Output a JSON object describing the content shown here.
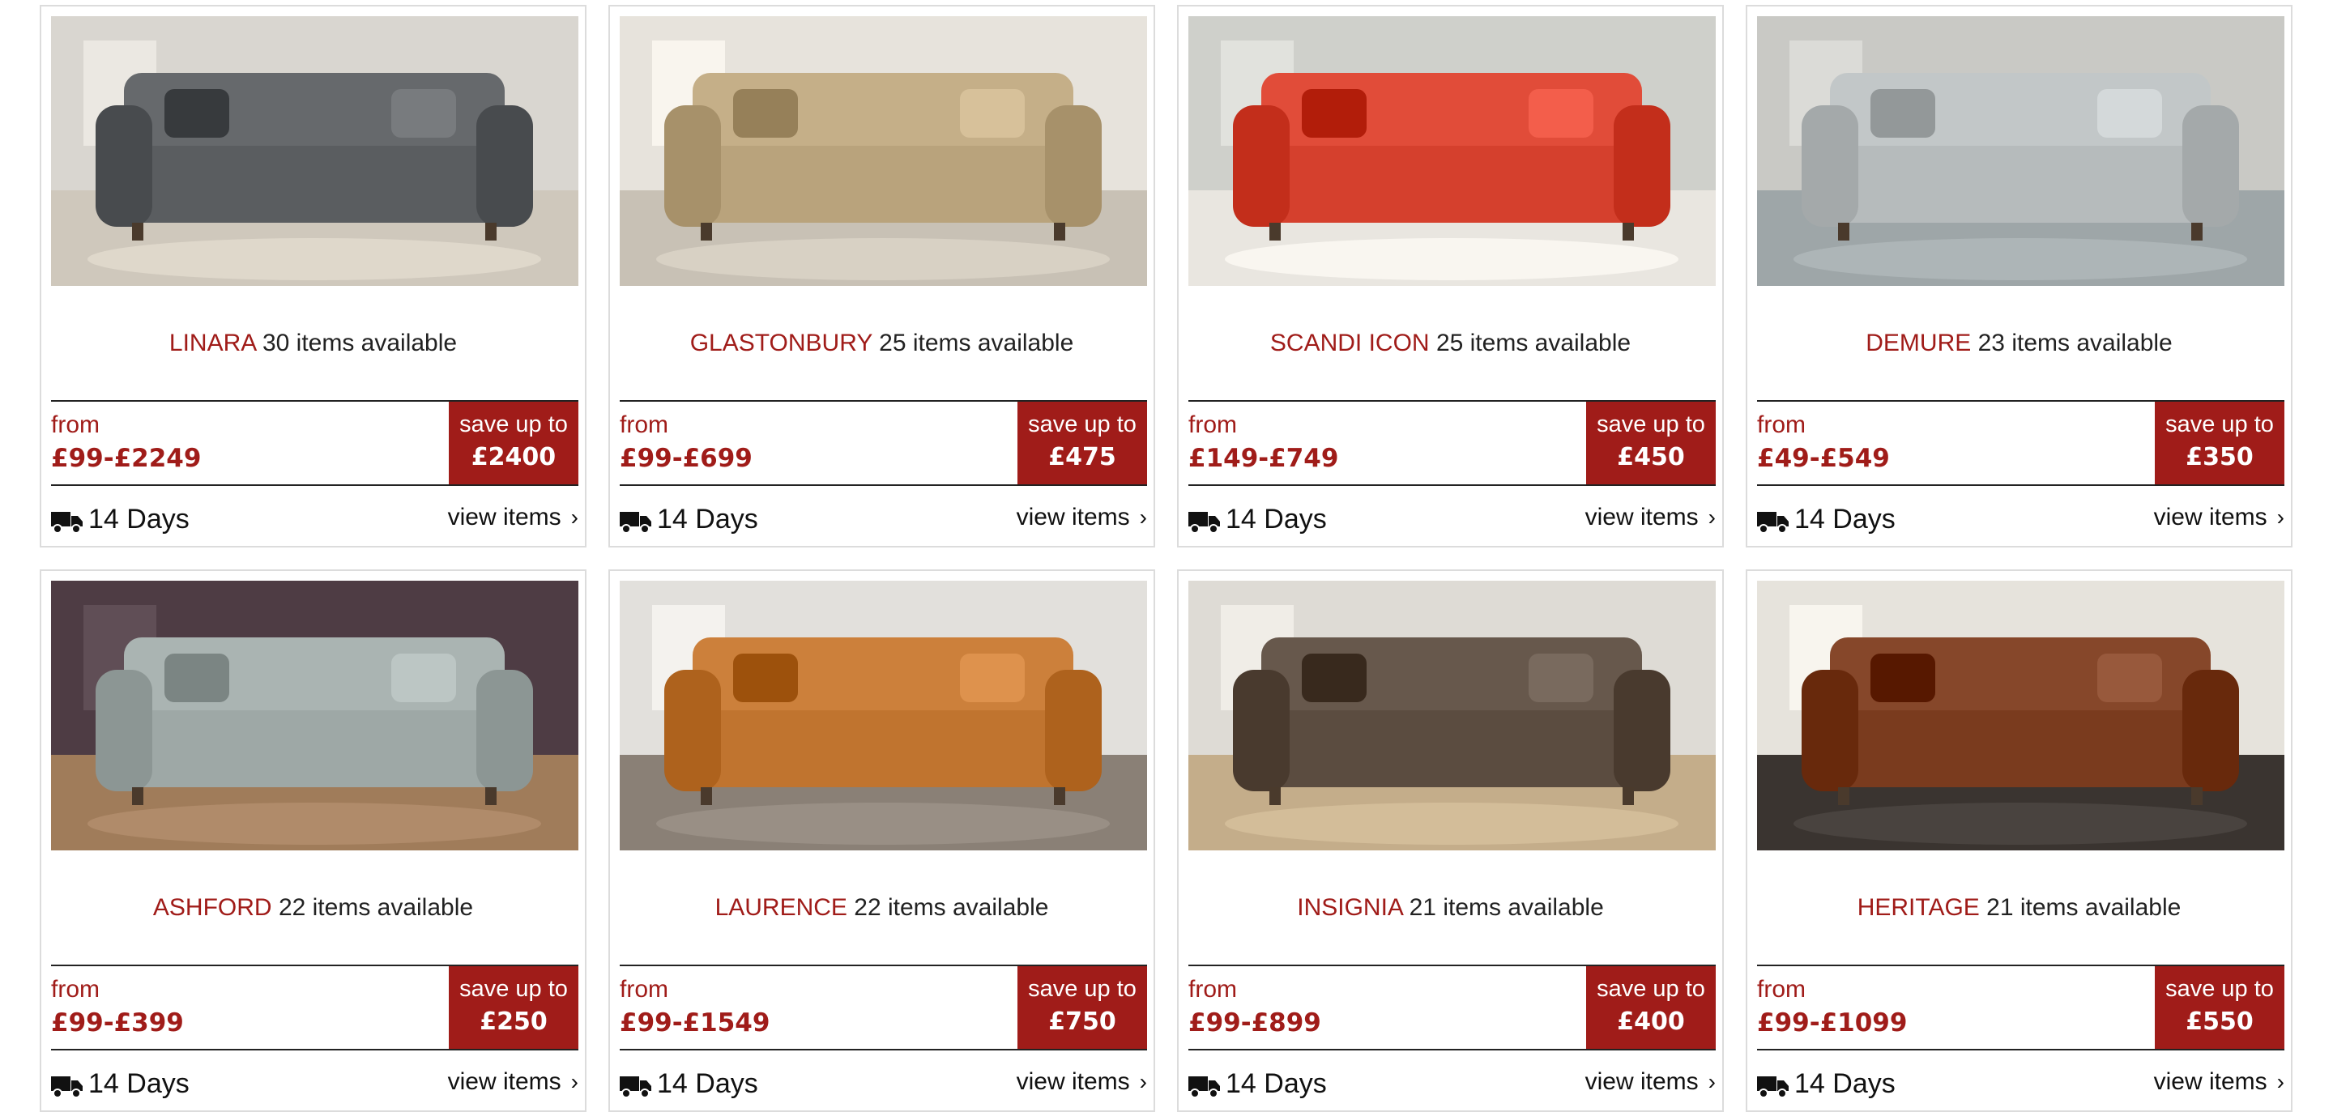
{
  "products": [
    {
      "name": "LINARA",
      "count": "30 items available",
      "from": "from",
      "range": "£99-£2249",
      "save_label": "save up to",
      "save_amount": "£2400",
      "delivery": "14 Days",
      "view": "view items",
      "image_desc": "grey leather sofa",
      "colors": {
        "sofa": "#5a5d60",
        "wall": "#d9d6d0",
        "floor": "#cfc8bc"
      }
    },
    {
      "name": "GLASTONBURY",
      "count": "25 items available",
      "from": "from",
      "range": "£99-£699",
      "save_label": "save up to",
      "save_amount": "£475",
      "delivery": "14 Days",
      "view": "view items",
      "image_desc": "beige fabric sofa",
      "colors": {
        "sofa": "#b9a37c",
        "wall": "#e7e3dc",
        "floor": "#c8c1b5"
      }
    },
    {
      "name": "SCANDI ICON",
      "count": "25 items available",
      "from": "from",
      "range": "£149-£749",
      "save_label": "save up to",
      "save_amount": "£450",
      "delivery": "14 Days",
      "view": "view items",
      "image_desc": "red fabric sofa",
      "colors": {
        "sofa": "#d5402d",
        "wall": "#cfd0cb",
        "floor": "#e9e6e0"
      }
    },
    {
      "name": "DEMURE",
      "count": "23 items available",
      "from": "from",
      "range": "£49-£549",
      "save_label": "save up to",
      "save_amount": "£350",
      "delivery": "14 Days",
      "view": "view items",
      "image_desc": "light grey corner sofa",
      "colors": {
        "sofa": "#b6bbbc",
        "wall": "#c9c9c5",
        "floor": "#9ea6a8"
      }
    },
    {
      "name": "ASHFORD",
      "count": "22 items available",
      "from": "from",
      "range": "£99-£399",
      "save_label": "save up to",
      "save_amount": "£250",
      "delivery": "14 Days",
      "view": "view items",
      "image_desc": "sage green fabric sofa",
      "colors": {
        "sofa": "#9ea8a6",
        "wall": "#4e3c44",
        "floor": "#a07c5a"
      }
    },
    {
      "name": "LAURENCE",
      "count": "22 items available",
      "from": "from",
      "range": "£99-£1549",
      "save_label": "save up to",
      "save_amount": "£750",
      "delivery": "14 Days",
      "view": "view items",
      "image_desc": "tan leather corner recliner sofa",
      "colors": {
        "sofa": "#c0742f",
        "wall": "#e2e0dc",
        "floor": "#8a8076"
      }
    },
    {
      "name": "INSIGNIA",
      "count": "21 items available",
      "from": "from",
      "range": "£99-£899",
      "save_label": "save up to",
      "save_amount": "£400",
      "delivery": "14 Days",
      "view": "view items",
      "image_desc": "brown leather recliner sofa",
      "colors": {
        "sofa": "#5b4c40",
        "wall": "#dedbd5",
        "floor": "#c4ad8a"
      }
    },
    {
      "name": "HERITAGE",
      "count": "21 items available",
      "from": "from",
      "range": "£99-£1099",
      "save_label": "save up to",
      "save_amount": "£550",
      "delivery": "14 Days",
      "view": "view items",
      "image_desc": "chestnut leather recliner sofa",
      "colors": {
        "sofa": "#7a3b1e",
        "wall": "#e6e3dc",
        "floor": "#3a3430"
      }
    }
  ],
  "icons": {
    "delivery": "truck-icon",
    "view": "chevron-right-icon"
  },
  "theme": {
    "accent": "#a01c19",
    "border": "#dcdcdc"
  }
}
